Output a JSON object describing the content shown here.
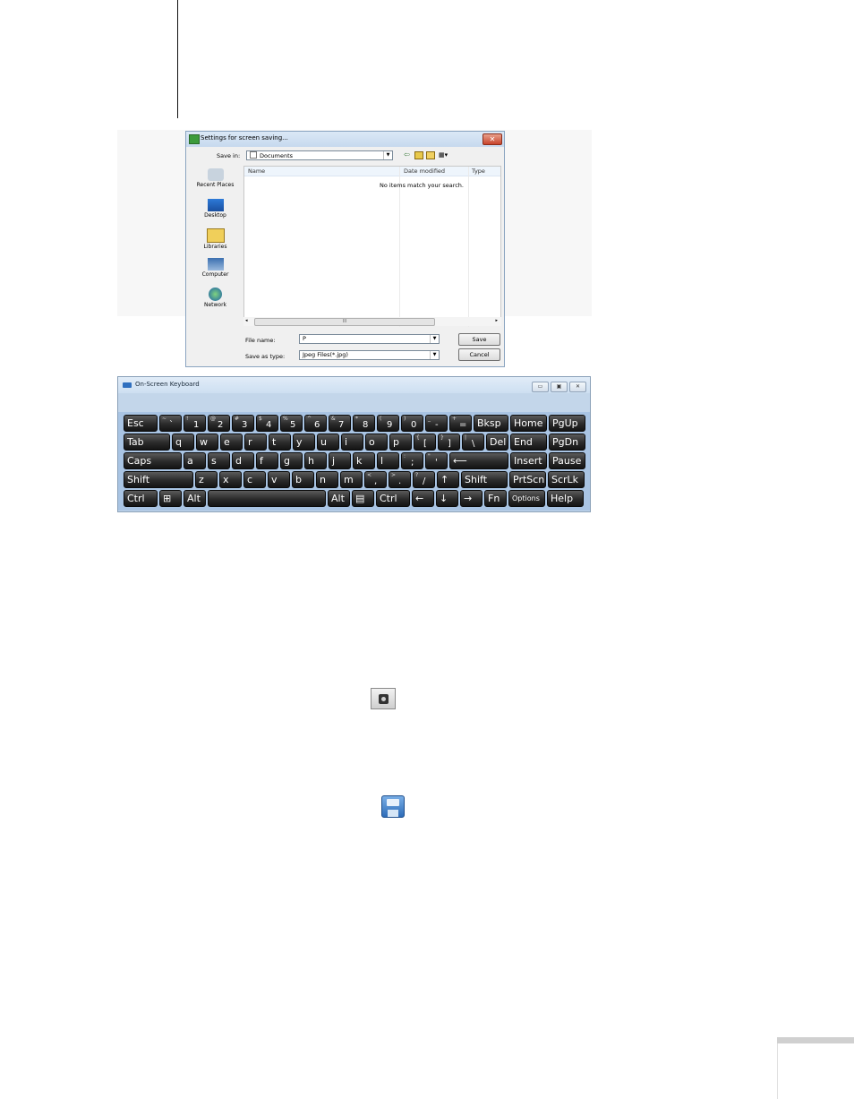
{
  "dialog": {
    "title": "Settings for screen saving...",
    "close_label": "✕",
    "save_in_label": "Save in:",
    "save_in_value": "Documents",
    "places": [
      {
        "label": "Recent Places",
        "icon": "recent-places-icon"
      },
      {
        "label": "Desktop",
        "icon": "desktop-icon"
      },
      {
        "label": "Libraries",
        "icon": "libraries-icon"
      },
      {
        "label": "Computer",
        "icon": "computer-icon"
      },
      {
        "label": "Network",
        "icon": "network-icon"
      }
    ],
    "columns": [
      "Name",
      "Date modified",
      "Type"
    ],
    "empty_message": "No items match your search.",
    "scroll_thumb": "III",
    "file_name_label": "File name:",
    "file_name_value": "P",
    "save_type_label": "Save as type:",
    "save_type_value": "Jpeg Files(*.jpg)",
    "save_button": "Save",
    "cancel_button": "Cancel"
  },
  "keyboard": {
    "title": "On-Screen Keyboard",
    "colors": {
      "key": "#2a2a2a",
      "panel": "#a9c4e3"
    },
    "rows": [
      [
        {
          "p": "Esc"
        },
        {
          "s": "~",
          "p": "`"
        },
        {
          "s": "!",
          "p": "1"
        },
        {
          "s": "@",
          "p": "2"
        },
        {
          "s": "#",
          "p": "3"
        },
        {
          "s": "$",
          "p": "4"
        },
        {
          "s": "%",
          "p": "5"
        },
        {
          "s": "^",
          "p": "6"
        },
        {
          "s": "&",
          "p": "7"
        },
        {
          "s": "*",
          "p": "8"
        },
        {
          "s": "(",
          "p": "9"
        },
        {
          "s": ")",
          "p": "0"
        },
        {
          "s": "_",
          "p": "-"
        },
        {
          "s": "+",
          "p": "="
        },
        {
          "p": "Bksp"
        },
        {
          "p": "Home"
        },
        {
          "p": "PgUp"
        }
      ],
      [
        {
          "p": "Tab"
        },
        {
          "p": "q"
        },
        {
          "p": "w"
        },
        {
          "p": "e"
        },
        {
          "p": "r"
        },
        {
          "p": "t"
        },
        {
          "p": "y"
        },
        {
          "p": "u"
        },
        {
          "p": "i"
        },
        {
          "p": "o"
        },
        {
          "p": "p"
        },
        {
          "s": "{",
          "p": "["
        },
        {
          "s": "}",
          "p": "]"
        },
        {
          "s": "|",
          "p": "\\"
        },
        {
          "p": "Del"
        },
        {
          "p": "End"
        },
        {
          "p": "PgDn"
        }
      ],
      [
        {
          "p": "Caps"
        },
        {
          "p": "a"
        },
        {
          "p": "s"
        },
        {
          "p": "d"
        },
        {
          "p": "f"
        },
        {
          "p": "g"
        },
        {
          "p": "h"
        },
        {
          "p": "j"
        },
        {
          "p": "k"
        },
        {
          "p": "l"
        },
        {
          "s": ":",
          "p": ";"
        },
        {
          "s": "\"",
          "p": "'"
        },
        {
          "p": "⟵"
        },
        {
          "p": "Insert"
        },
        {
          "p": "Pause"
        }
      ],
      [
        {
          "p": "Shift"
        },
        {
          "p": "z"
        },
        {
          "p": "x"
        },
        {
          "p": "c"
        },
        {
          "p": "v"
        },
        {
          "p": "b"
        },
        {
          "p": "n"
        },
        {
          "p": "m"
        },
        {
          "s": "<",
          "p": ","
        },
        {
          "s": ">",
          "p": "."
        },
        {
          "s": "?",
          "p": "/"
        },
        {
          "p": "↑"
        },
        {
          "p": "Shift"
        },
        {
          "p": "PrtScn"
        },
        {
          "p": "ScrLk"
        }
      ],
      [
        {
          "p": "Ctrl"
        },
        {
          "p": "⊞"
        },
        {
          "p": "Alt"
        },
        {
          "p": ""
        },
        {
          "p": "Alt"
        },
        {
          "p": "▤"
        },
        {
          "p": "Ctrl"
        },
        {
          "p": "←"
        },
        {
          "p": "↓"
        },
        {
          "p": "→"
        },
        {
          "p": "Fn"
        },
        {
          "p": "Options"
        },
        {
          "p": "Help"
        }
      ]
    ]
  },
  "icons": {
    "camera": "camera-icon",
    "floppy": "floppy-disk-icon"
  }
}
